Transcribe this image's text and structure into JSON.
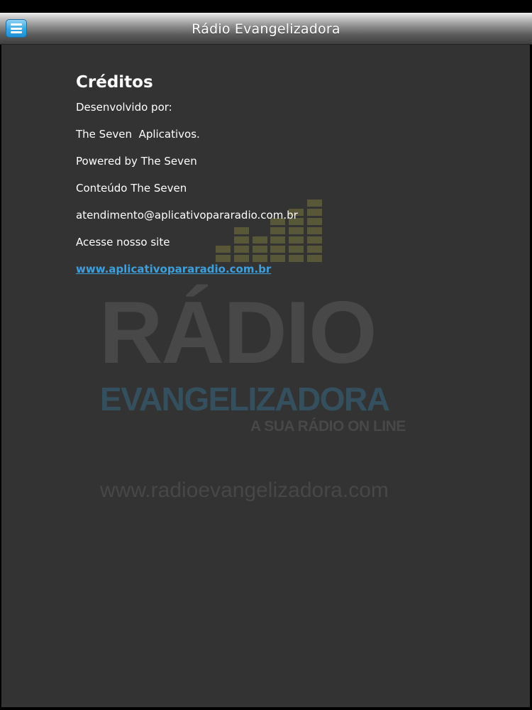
{
  "header": {
    "title": "Rádio Evangelizadora",
    "menu_icon": "hamburger-menu-icon"
  },
  "credits": {
    "title": "Créditos",
    "lines": [
      "Desenvolvido por:",
      "The Seven  Aplicativos.",
      "Powered by The Seven",
      "Conteúdo The Seven",
      "atendimento@aplicativopararadio.com.br",
      "Acesse nosso site"
    ],
    "link": "www.aplicativopararadio.com.br"
  },
  "watermark": {
    "radio": "RÁDIO",
    "name": "EVANGELIZADORA",
    "tagline": "A SUA RÁDIO ON LINE",
    "url": "www.radioevangelizadora.com",
    "icon": "equalizer-bars-icon"
  },
  "colors": {
    "background": "#333333",
    "link": "#3d9fdc",
    "menu_button": "#35a6e4",
    "watermark_blue": "#34505f",
    "watermark_bars": "#585839"
  }
}
